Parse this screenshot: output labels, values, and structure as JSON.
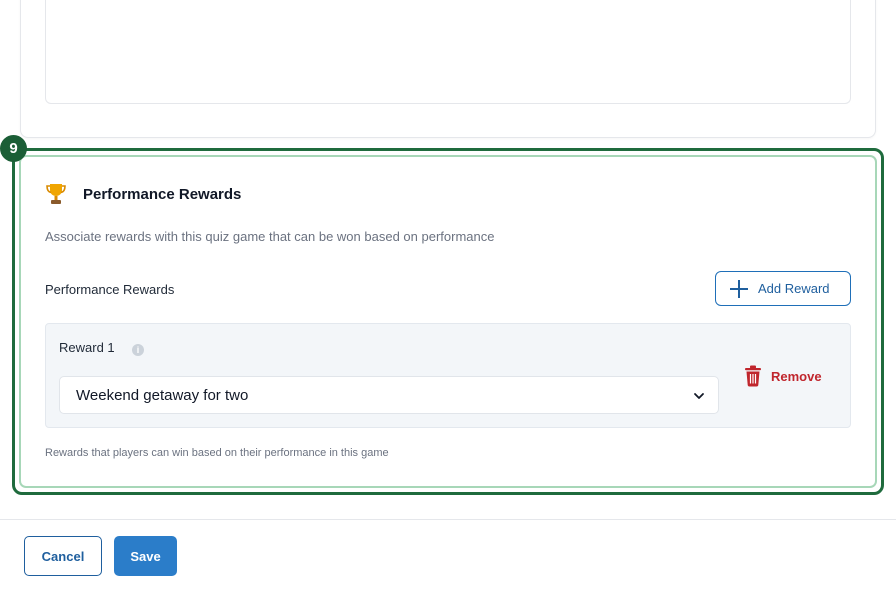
{
  "step_number": "9",
  "section": {
    "title": "Performance Rewards",
    "description": "Associate rewards with this quiz game that can be won based on performance",
    "field_label": "Performance Rewards",
    "add_button_label": "Add Reward",
    "help_text": "Rewards that players can win based on their performance in this game",
    "rewards": [
      {
        "label": "Reward 1",
        "selected_value": "Weekend getaway for two",
        "remove_label": "Remove"
      }
    ]
  },
  "footer": {
    "cancel_label": "Cancel",
    "save_label": "Save"
  },
  "icons": {
    "section_icon": "trophy-icon",
    "add_icon": "plus-icon",
    "info_icon": "info-icon",
    "dropdown_icon": "chevron-down-icon",
    "remove_icon": "trash-icon"
  },
  "colors": {
    "highlight_border": "#1f6b3d",
    "highlight_inner": "#a7d7b8",
    "primary": "#2b7dc9",
    "danger": "#c0262d"
  }
}
